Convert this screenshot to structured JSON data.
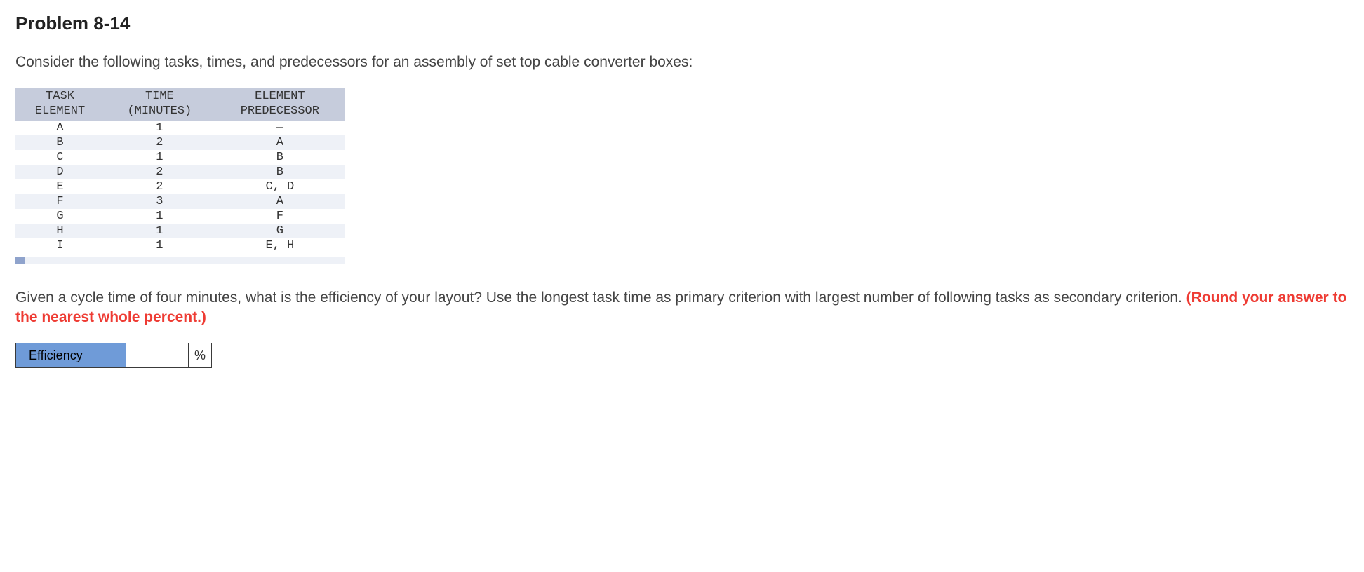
{
  "title": "Problem 8-14",
  "intro": "Consider the following tasks, times, and predecessors for an assembly of set top cable converter boxes:",
  "table": {
    "headers": {
      "task": "TASK\nELEMENT",
      "time": "TIME\n(MINUTES)",
      "pred": "ELEMENT\nPREDECESSOR"
    },
    "rows": [
      {
        "task": "A",
        "time": "1",
        "pred": "—"
      },
      {
        "task": "B",
        "time": "2",
        "pred": "A"
      },
      {
        "task": "C",
        "time": "1",
        "pred": "B"
      },
      {
        "task": "D",
        "time": "2",
        "pred": "B"
      },
      {
        "task": "E",
        "time": "2",
        "pred": "C, D"
      },
      {
        "task": "F",
        "time": "3",
        "pred": "A"
      },
      {
        "task": "G",
        "time": "1",
        "pred": "F"
      },
      {
        "task": "H",
        "time": "1",
        "pred": "G"
      },
      {
        "task": "I",
        "time": "1",
        "pred": "E, H"
      }
    ]
  },
  "question": {
    "part1": "Given a cycle time of four minutes, what is the efficiency of your layout? Use the longest task time as primary criterion with largest number of following tasks as secondary criterion. ",
    "part2": "(Round your answer to the nearest whole percent.)"
  },
  "answer": {
    "label": "Efficiency",
    "value": "",
    "unit": "%"
  }
}
